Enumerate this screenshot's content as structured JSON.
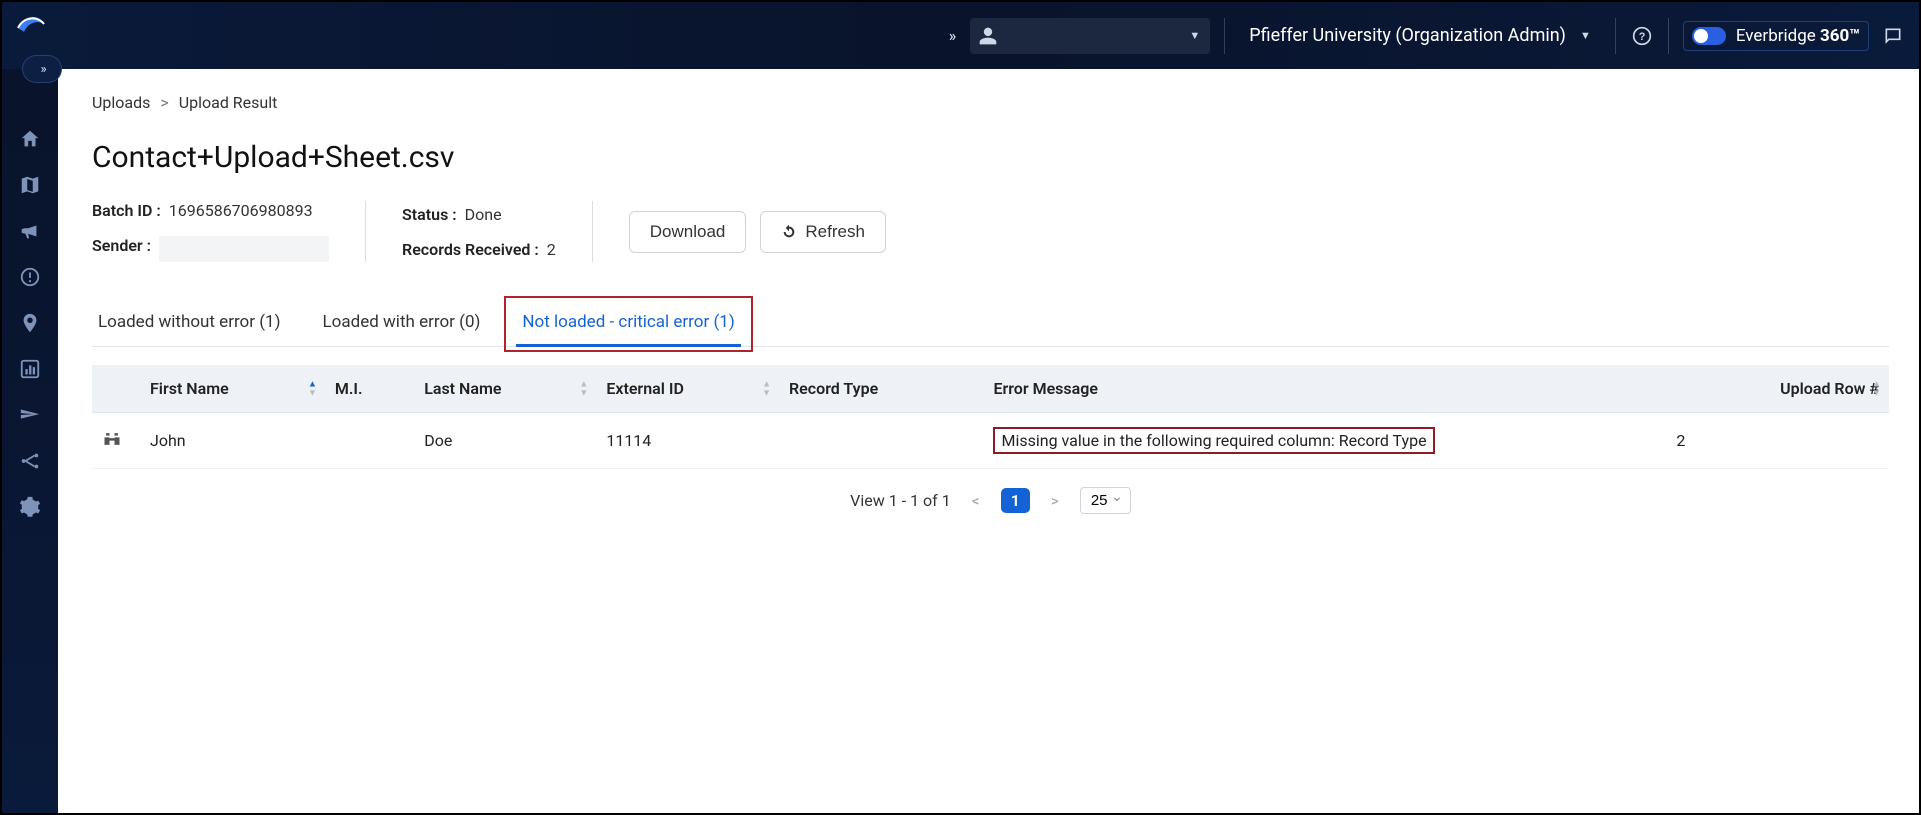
{
  "header": {
    "org_label": "Pfieffer University (Organization Admin)",
    "product_prefix": "Everbridge",
    "product_suffix": "360™",
    "user_name": ""
  },
  "breadcrumb": {
    "root": "Uploads",
    "current": "Upload Result"
  },
  "page_title": "Contact+Upload+Sheet.csv",
  "meta": {
    "batch_id_label": "Batch ID :",
    "batch_id_value": "1696586706980893",
    "sender_label": "Sender :",
    "sender_value": "",
    "status_label": "Status :",
    "status_value": "Done",
    "records_received_label": "Records Received :",
    "records_received_value": "2"
  },
  "buttons": {
    "download": "Download",
    "refresh": "Refresh"
  },
  "tabs": {
    "loaded_ok": "Loaded without error (1)",
    "loaded_err": "Loaded with error (0)",
    "not_loaded": "Not loaded - critical error (1)"
  },
  "table": {
    "headers": {
      "first_name": "First Name",
      "mi": "M.I.",
      "last_name": "Last Name",
      "external_id": "External ID",
      "record_type": "Record Type",
      "error_message": "Error Message",
      "upload_row": "Upload Row #"
    },
    "rows": [
      {
        "first_name": "John",
        "mi": "",
        "last_name": "Doe",
        "external_id": "11114",
        "record_type": "",
        "error_message": "Missing value in the following required column: Record Type",
        "upload_row": "2"
      }
    ]
  },
  "pager": {
    "summary": "View 1 - 1 of 1",
    "page": "1",
    "page_size": "25"
  }
}
